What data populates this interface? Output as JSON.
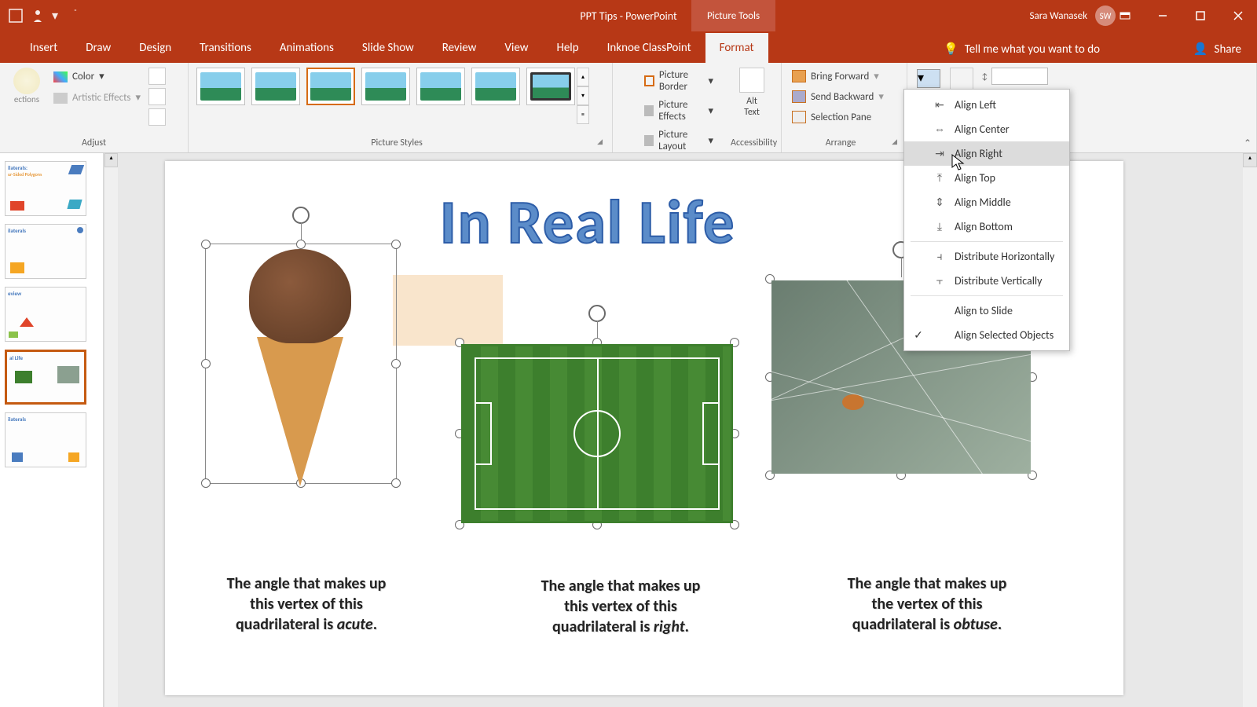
{
  "title_bar": {
    "doc_title": "PPT Tips  -  PowerPoint",
    "context_tab": "Picture Tools",
    "user_name": "Sara Wanasek",
    "user_initials": "SW"
  },
  "tabs": {
    "insert": "Insert",
    "draw": "Draw",
    "design": "Design",
    "transitions": "Transitions",
    "animations": "Animations",
    "slideshow": "Slide Show",
    "review": "Review",
    "view": "View",
    "help": "Help",
    "classpoint": "Inknoe ClassPoint",
    "format": "Format",
    "tell_me": "Tell me what you want to do",
    "share": "Share"
  },
  "ribbon": {
    "adjust": {
      "corrections": "ections",
      "color": "Color",
      "artistic": "Artistic Effects",
      "label": "Adjust"
    },
    "styles": {
      "label": "Picture Styles",
      "border": "Picture Border",
      "effects": "Picture Effects",
      "layout": "Picture Layout"
    },
    "accessibility": {
      "alt1": "Alt",
      "alt2": "Text",
      "label": "Accessibility"
    },
    "arrange": {
      "forward": "Bring Forward",
      "backward": "Send Backward",
      "selection": "Selection Pane",
      "label": "Arrange"
    }
  },
  "align_menu": {
    "left": "Align Left",
    "center": "Align Center",
    "right": "Align Right",
    "top": "Align Top",
    "middle": "Align Middle",
    "bottom": "Align Bottom",
    "dist_h": "Distribute Horizontally",
    "dist_v": "Distribute Vertically",
    "to_slide": "Align to Slide",
    "to_objects": "Align Selected Objects"
  },
  "slide": {
    "title": "In Real Life",
    "caption1_a": "The angle that makes up",
    "caption1_b": "this vertex of this",
    "caption1_c": "quadrilateral  is ",
    "caption1_em": "acute",
    "caption1_end": ".",
    "caption2_a": "The angle that makes up",
    "caption2_b": "this vertex of this",
    "caption2_c": "quadrilateral  is ",
    "caption2_em": "right",
    "caption2_end": ".",
    "caption3_a": "The angle that makes up",
    "caption3_b": "the vertex of this",
    "caption3_c": "quadrilateral  is ",
    "caption3_em": "obtuse",
    "caption3_end": "."
  },
  "thumbs": {
    "t1": "ilaterals:",
    "t1b": "ur-Sided Polygons",
    "t2": "ilaterals",
    "t3": "eview",
    "t4": "al Life",
    "t5": "ilaterals"
  }
}
